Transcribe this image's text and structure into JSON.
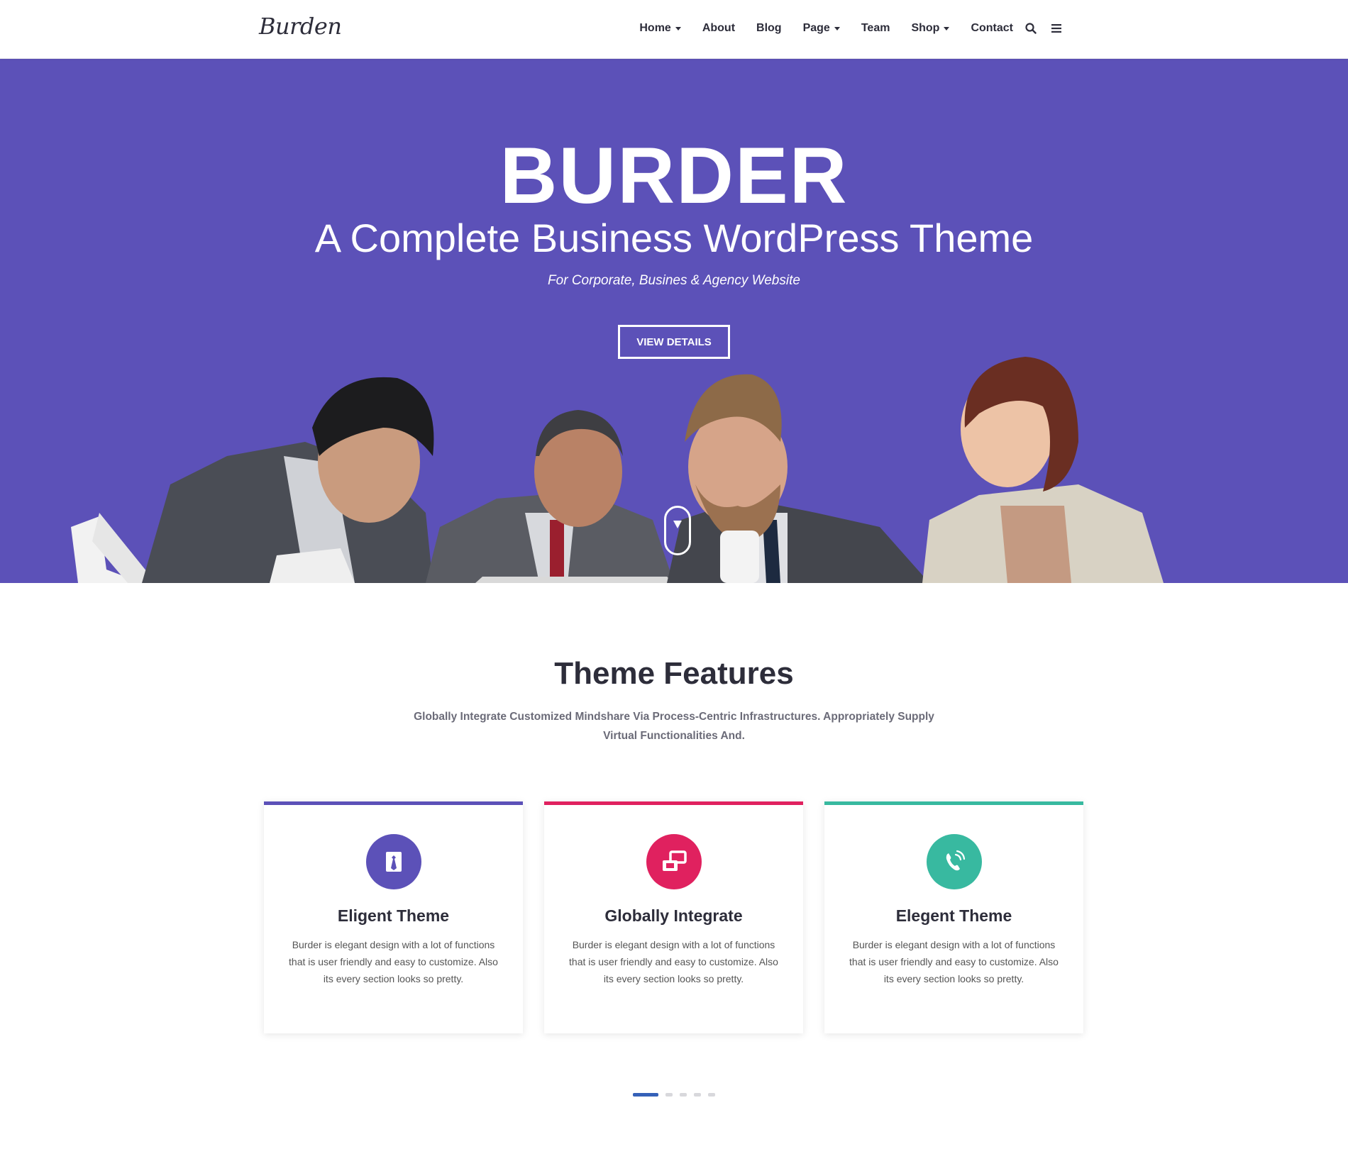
{
  "header": {
    "logo": "Burden",
    "nav": [
      {
        "label": "Home",
        "dropdown": true
      },
      {
        "label": "About",
        "dropdown": false
      },
      {
        "label": "Blog",
        "dropdown": false
      },
      {
        "label": "Page",
        "dropdown": true
      },
      {
        "label": "Team",
        "dropdown": false
      },
      {
        "label": "Shop",
        "dropdown": true
      },
      {
        "label": "Contact",
        "dropdown": false
      }
    ],
    "icons": [
      "search-icon",
      "menu-icon"
    ]
  },
  "hero": {
    "title": "BURDER",
    "subtitle": "A Complete Business WordPress Theme",
    "tagline": "For Corporate, Busines & Agency Website",
    "button_label": "VIEW DETAILS",
    "background_color": "#5c51b8"
  },
  "features": {
    "title": "Theme Features",
    "description": "Globally Integrate Customized Mindshare Via Process-Centric Infrastructures. Appropriately Supply Virtual Functionalities And.",
    "cards": [
      {
        "title": "Eligent Theme",
        "text": "Burder is elegant design with a lot of functions that is user friendly and easy to customize. Also its every section looks so pretty.",
        "color": "#5c51b8",
        "icon": "tie-icon"
      },
      {
        "title": "Globally Integrate",
        "text": "Burder is elegant design with a lot of functions that is user friendly and easy to customize. Also its every section looks so pretty.",
        "color": "#e0215f",
        "icon": "windows-icon"
      },
      {
        "title": "Elegent Theme",
        "text": "Burder is elegant design with a lot of functions that is user friendly and easy to customize. Also its every section looks so pretty.",
        "color": "#38b9a0",
        "icon": "phone-icon"
      }
    ],
    "pagination": {
      "count": 5,
      "active": 1
    }
  }
}
